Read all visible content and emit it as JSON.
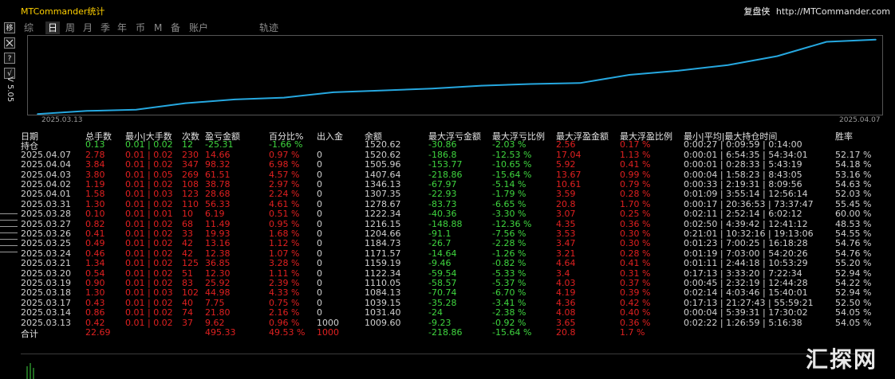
{
  "app": {
    "title": "MTCommander统计",
    "brand_cn": "复盘侠",
    "brand_url": "http://MTCommander.com",
    "version": "V 5.05"
  },
  "side_buttons": [
    "移",
    "",
    "?",
    "√"
  ],
  "tabs": [
    {
      "label": "综",
      "active": false
    },
    {
      "label": "日",
      "active": true
    },
    {
      "label": "周",
      "active": false
    },
    {
      "label": "月",
      "active": false
    },
    {
      "label": "季",
      "active": false
    },
    {
      "label": "年",
      "active": false
    },
    {
      "label": "币",
      "active": false
    },
    {
      "label": "M",
      "active": false
    },
    {
      "label": "备",
      "active": false
    },
    {
      "label": "账户",
      "active": false
    },
    {
      "label": "轨迹",
      "active": false
    }
  ],
  "chart_data": {
    "type": "line",
    "x_start_label": "2025.03.13",
    "x_end_label": "2025.04.07",
    "x": [
      "2025.03.13",
      "2025.03.14",
      "2025.03.17",
      "2025.03.18",
      "2025.03.19",
      "2025.03.20",
      "2025.03.21",
      "2025.03.24",
      "2025.03.25",
      "2025.03.26",
      "2025.03.27",
      "2025.03.28",
      "2025.03.31",
      "2025.04.01",
      "2025.04.02",
      "2025.04.03",
      "2025.04.04",
      "2025.04.07"
    ],
    "values": [
      1009.6,
      1031.4,
      1039.15,
      1084.13,
      1110.05,
      1122.34,
      1159.19,
      1171.57,
      1184.73,
      1204.66,
      1216.15,
      1222.34,
      1278.67,
      1307.35,
      1346.13,
      1407.64,
      1505.96,
      1520.62
    ],
    "color": "#26a8e0",
    "grid": false
  },
  "table": {
    "headers": [
      "日期",
      "总手数",
      "最小|大手数",
      "次数",
      "盈亏金额",
      "百分比%",
      "出入金",
      "余额",
      "最大浮亏金额",
      "最大浮亏比例",
      "最大浮盈金额",
      "最大浮盈比例",
      "最小|平均|最大持仓时间",
      "胜率"
    ],
    "open": {
      "label": "持仓",
      "lots": "0.13",
      "minmax": "0.01 | 0.02",
      "count": "12",
      "pnl": "-25.31",
      "pct": "-1.66 %",
      "flow": "",
      "balance": "1520.62",
      "maxloss": "-30.86",
      "maxlosspct": "-2.03 %",
      "maxgain": "2.56",
      "maxgainpct": "0.17 %",
      "hold": "0:00:27 | 0:09:59 | 0:14:00",
      "win": ""
    },
    "rows": [
      {
        "date": "2025.04.07",
        "lots": "2.78",
        "minmax": "0.01 | 0.02",
        "count": "230",
        "pnl": "14.66",
        "pct": "0.97 %",
        "flow": "0",
        "balance": "1520.62",
        "maxloss": "-186.8",
        "maxlosspct": "-12.53 %",
        "maxgain": "17.04",
        "maxgainpct": "1.13 %",
        "hold": "0:00:01 | 6:54:35 | 54:34:01",
        "win": "52.17 %"
      },
      {
        "date": "2025.04.04",
        "lots": "3.84",
        "minmax": "0.01 | 0.02",
        "count": "347",
        "pnl": "98.32",
        "pct": "6.98 %",
        "flow": "0",
        "balance": "1505.96",
        "maxloss": "-153.77",
        "maxlosspct": "-10.65 %",
        "maxgain": "5.92",
        "maxgainpct": "0.41 %",
        "hold": "0:00:01 | 0:28:33 | 5:43:19",
        "win": "54.18 %"
      },
      {
        "date": "2025.04.03",
        "lots": "3.80",
        "minmax": "0.01 | 0.05",
        "count": "269",
        "pnl": "61.51",
        "pct": "4.57 %",
        "flow": "0",
        "balance": "1407.64",
        "maxloss": "-218.86",
        "maxlosspct": "-15.64 %",
        "maxgain": "13.67",
        "maxgainpct": "0.99 %",
        "hold": "0:00:04 | 1:58:23 | 8:43:05",
        "win": "53.16 %"
      },
      {
        "date": "2025.04.02",
        "lots": "1.19",
        "minmax": "0.01 | 0.02",
        "count": "108",
        "pnl": "38.78",
        "pct": "2.97 %",
        "flow": "0",
        "balance": "1346.13",
        "maxloss": "-67.97",
        "maxlosspct": "-5.14 %",
        "maxgain": "10.61",
        "maxgainpct": "0.79 %",
        "hold": "0:00:33 | 2:19:31 | 8:09:56",
        "win": "54.63 %"
      },
      {
        "date": "2025.04.01",
        "lots": "1.58",
        "minmax": "0.01 | 0.03",
        "count": "123",
        "pnl": "28.68",
        "pct": "2.24 %",
        "flow": "0",
        "balance": "1307.35",
        "maxloss": "-22.93",
        "maxlosspct": "-1.79 %",
        "maxgain": "3.59",
        "maxgainpct": "0.28 %",
        "hold": "0:01:09 | 3:55:14 | 12:56:14",
        "win": "52.03 %"
      },
      {
        "date": "2025.03.31",
        "lots": "1.30",
        "minmax": "0.01 | 0.02",
        "count": "110",
        "pnl": "56.33",
        "pct": "4.61 %",
        "flow": "0",
        "balance": "1278.67",
        "maxloss": "-83.73",
        "maxlosspct": "-6.65 %",
        "maxgain": "20.8",
        "maxgainpct": "1.70 %",
        "hold": "0:00:17 | 20:36:53 | 73:37:47",
        "win": "55.45 %"
      },
      {
        "date": "2025.03.28",
        "lots": "0.10",
        "minmax": "0.01 | 0.01",
        "count": "10",
        "pnl": "6.19",
        "pct": "0.51 %",
        "flow": "0",
        "balance": "1222.34",
        "maxloss": "-40.36",
        "maxlosspct": "-3.30 %",
        "maxgain": "3.07",
        "maxgainpct": "0.25 %",
        "hold": "0:02:11 | 2:52:14 | 6:02:12",
        "win": "60.00 %"
      },
      {
        "date": "2025.03.27",
        "lots": "0.82",
        "minmax": "0.01 | 0.02",
        "count": "68",
        "pnl": "11.49",
        "pct": "0.95 %",
        "flow": "0",
        "balance": "1216.15",
        "maxloss": "-148.88",
        "maxlosspct": "-12.36 %",
        "maxgain": "4.35",
        "maxgainpct": "0.36 %",
        "hold": "0:02:50 | 4:39:42 | 12:41:12",
        "win": "48.53 %"
      },
      {
        "date": "2025.03.26",
        "lots": "0.41",
        "minmax": "0.01 | 0.02",
        "count": "33",
        "pnl": "19.93",
        "pct": "1.68 %",
        "flow": "0",
        "balance": "1204.66",
        "maxloss": "-91.1",
        "maxlosspct": "-7.56 %",
        "maxgain": "3.53",
        "maxgainpct": "0.30 %",
        "hold": "0:21:01 | 10:32:16 | 19:13:06",
        "win": "54.55 %"
      },
      {
        "date": "2025.03.25",
        "lots": "0.49",
        "minmax": "0.01 | 0.02",
        "count": "42",
        "pnl": "13.16",
        "pct": "1.12 %",
        "flow": "0",
        "balance": "1184.73",
        "maxloss": "-26.7",
        "maxlosspct": "-2.28 %",
        "maxgain": "3.47",
        "maxgainpct": "0.30 %",
        "hold": "0:01:23 | 7:00:25 | 16:18:28",
        "win": "54.76 %"
      },
      {
        "date": "2025.03.24",
        "lots": "0.46",
        "minmax": "0.01 | 0.02",
        "count": "42",
        "pnl": "12.38",
        "pct": "1.07 %",
        "flow": "0",
        "balance": "1171.57",
        "maxloss": "-14.64",
        "maxlosspct": "-1.26 %",
        "maxgain": "3.21",
        "maxgainpct": "0.28 %",
        "hold": "0:01:19 | 7:03:00 | 54:20:26",
        "win": "54.76 %"
      },
      {
        "date": "2025.03.21",
        "lots": "1.34",
        "minmax": "0.01 | 0.02",
        "count": "125",
        "pnl": "36.85",
        "pct": "3.28 %",
        "flow": "0",
        "balance": "1159.19",
        "maxloss": "-9.46",
        "maxlosspct": "-0.82 %",
        "maxgain": "4.64",
        "maxgainpct": "0.41 %",
        "hold": "0:01:11 | 2:44:18 | 10:53:29",
        "win": "55.20 %"
      },
      {
        "date": "2025.03.20",
        "lots": "0.54",
        "minmax": "0.01 | 0.02",
        "count": "51",
        "pnl": "12.30",
        "pct": "1.11 %",
        "flow": "0",
        "balance": "1122.34",
        "maxloss": "-59.54",
        "maxlosspct": "-5.33 %",
        "maxgain": "3.4",
        "maxgainpct": "0.31 %",
        "hold": "0:17:13 | 3:33:20 | 7:22:34",
        "win": "52.94 %"
      },
      {
        "date": "2025.03.19",
        "lots": "0.90",
        "minmax": "0.01 | 0.02",
        "count": "83",
        "pnl": "25.92",
        "pct": "2.39 %",
        "flow": "0",
        "balance": "1110.05",
        "maxloss": "-58.57",
        "maxlosspct": "-5.37 %",
        "maxgain": "4.03",
        "maxgainpct": "0.37 %",
        "hold": "0:00:45 | 2:32:19 | 12:44:28",
        "win": "54.22 %"
      },
      {
        "date": "2025.03.18",
        "lots": "1.30",
        "minmax": "0.01 | 0.03",
        "count": "102",
        "pnl": "44.98",
        "pct": "4.33 %",
        "flow": "0",
        "balance": "1084.13",
        "maxloss": "-70.74",
        "maxlosspct": "-6.70 %",
        "maxgain": "4.19",
        "maxgainpct": "0.39 %",
        "hold": "0:02:14 | 4:03:46 | 15:40:01",
        "win": "52.94 %"
      },
      {
        "date": "2025.03.17",
        "lots": "0.43",
        "minmax": "0.01 | 0.02",
        "count": "40",
        "pnl": "7.75",
        "pct": "0.75 %",
        "flow": "0",
        "balance": "1039.15",
        "maxloss": "-35.28",
        "maxlosspct": "-3.41 %",
        "maxgain": "4.36",
        "maxgainpct": "0.42 %",
        "hold": "0:17:13 | 21:27:43 | 55:59:21",
        "win": "52.50 %"
      },
      {
        "date": "2025.03.14",
        "lots": "0.86",
        "minmax": "0.01 | 0.02",
        "count": "74",
        "pnl": "21.80",
        "pct": "2.16 %",
        "flow": "0",
        "balance": "1031.40",
        "maxloss": "-24",
        "maxlosspct": "-2.38 %",
        "maxgain": "4.08",
        "maxgainpct": "0.40 %",
        "hold": "0:00:04 | 5:39:31 | 17:30:02",
        "win": "54.05 %"
      },
      {
        "date": "2025.03.13",
        "lots": "0.42",
        "minmax": "0.01 | 0.02",
        "count": "37",
        "pnl": "9.62",
        "pct": "0.96 %",
        "flow": "1000",
        "balance": "1009.60",
        "maxloss": "-9.23",
        "maxlosspct": "-0.92 %",
        "maxgain": "3.65",
        "maxgainpct": "0.36 %",
        "hold": "0:02:22 | 1:26:59 | 5:16:38",
        "win": "54.05 %"
      }
    ],
    "total": {
      "label": "合计",
      "lots": "22.69",
      "minmax": "",
      "count": "",
      "pnl": "495.33",
      "pct": "49.53 %",
      "flow": "1000",
      "balance": "",
      "maxloss": "-218.86",
      "maxlosspct": "-15.64 %",
      "maxgain": "20.8",
      "maxgainpct": "1.7 %",
      "hold": "",
      "win": ""
    }
  },
  "watermark": "汇探网",
  "colors": {
    "positive": "#3fd63f",
    "negative": "#e02020",
    "accent": "#ffd000",
    "line": "#26a8e0"
  }
}
